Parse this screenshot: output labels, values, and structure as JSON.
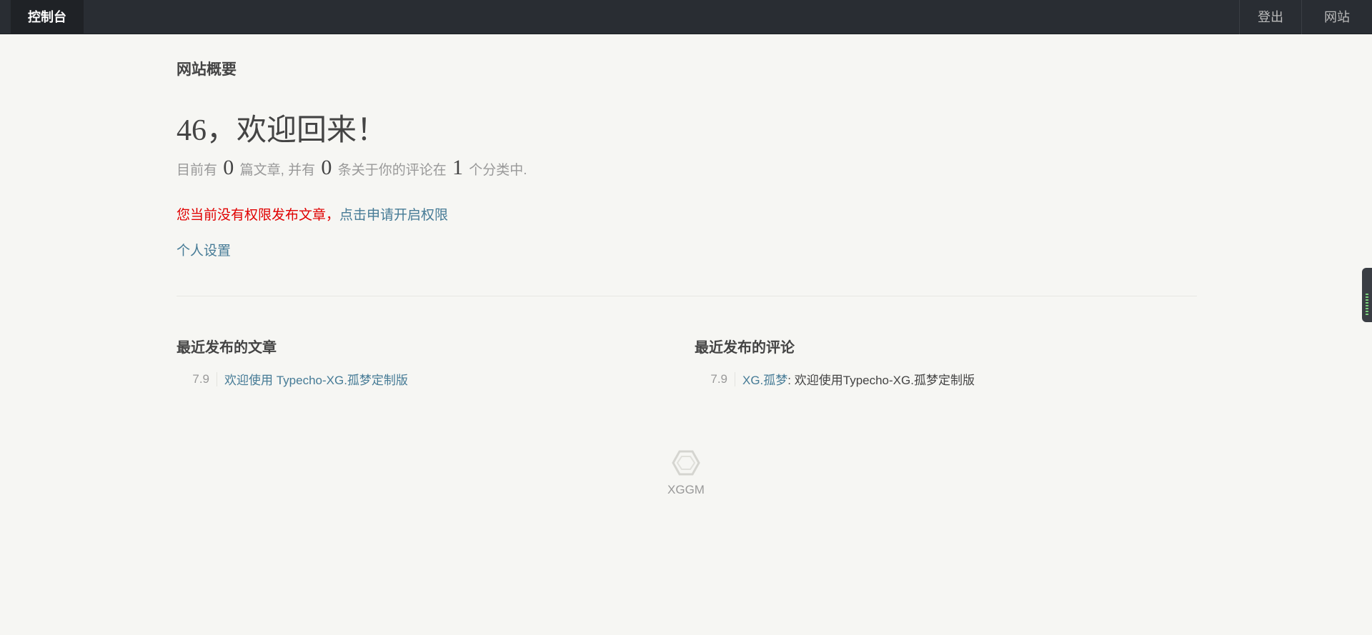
{
  "topbar": {
    "console_label": "控制台",
    "logout_label": "登出",
    "site_label": "网站"
  },
  "main": {
    "page_title": "网站概要",
    "welcome": "46，欢迎回来！",
    "stats": {
      "prefix": "目前有",
      "posts": "0",
      "mid1": "篇文章, 并有",
      "comments": "0",
      "mid2": "条关于你的评论在",
      "categories": "1",
      "suffix": "个分类中."
    },
    "warning_text": "您当前没有权限发布文章，",
    "warning_link": "点击申请开启权限",
    "profile_link": "个人设置"
  },
  "recent_posts": {
    "heading": "最近发布的文章",
    "items": [
      {
        "date": "7.9",
        "title": "欢迎使用 Typecho-XG.孤梦定制版"
      }
    ]
  },
  "recent_comments": {
    "heading": "最近发布的评论",
    "items": [
      {
        "date": "7.9",
        "author": "XG.孤梦",
        "text": ": 欢迎使用Typecho-XG.孤梦定制版"
      }
    ]
  },
  "footer": {
    "logo_icon": "typecho-logo-icon",
    "brand": "XGGM"
  }
}
